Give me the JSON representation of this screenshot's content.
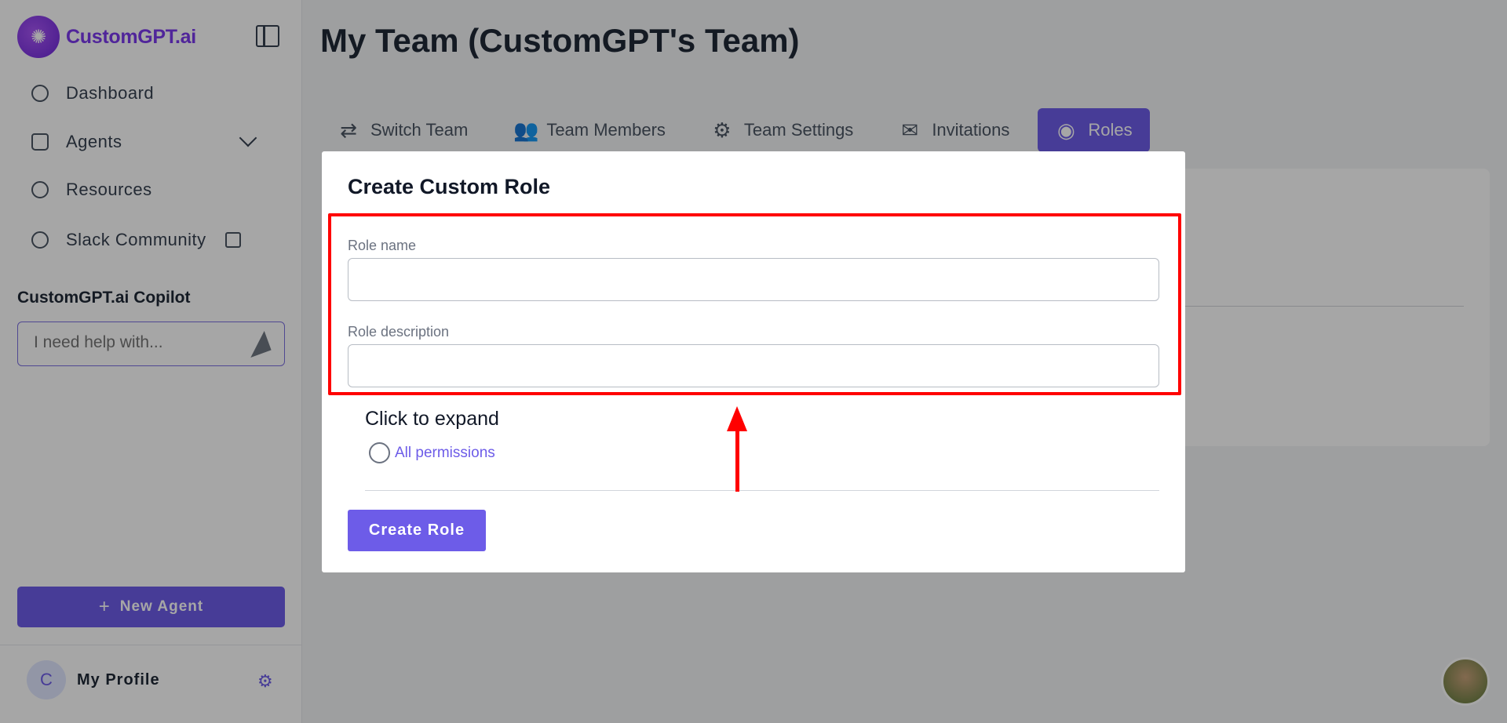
{
  "brand": {
    "name": "CustomGPT.ai"
  },
  "sidebar": {
    "items": [
      {
        "label": "Dashboard"
      },
      {
        "label": "Agents"
      },
      {
        "label": "Resources"
      },
      {
        "label": "Slack Community"
      }
    ],
    "copilot": {
      "title": "CustomGPT.ai Copilot",
      "placeholder": "I need help with..."
    },
    "new_agent_label": "New Agent",
    "profile": {
      "initial": "C",
      "name": "My Profile"
    }
  },
  "main": {
    "title": "My Team (CustomGPT's Team)",
    "tabs": [
      {
        "label": "Switch Team",
        "icon": "switch-icon"
      },
      {
        "label": "Team Members",
        "icon": "users-icon"
      },
      {
        "label": "Team Settings",
        "icon": "gear-icon"
      },
      {
        "label": "Invitations",
        "icon": "mail-icon"
      },
      {
        "label": "Roles",
        "icon": "user-circle-icon",
        "active": true
      }
    ]
  },
  "modal": {
    "title": "Create Custom Role",
    "role_name_label": "Role name",
    "role_name_value": "",
    "role_description_label": "Role description",
    "role_description_value": "",
    "expand_title": "Click to expand",
    "all_permissions_label": "All permissions",
    "create_button_label": "Create Role"
  },
  "colors": {
    "accent": "#6d5ce8",
    "highlight": "#ff0000"
  }
}
